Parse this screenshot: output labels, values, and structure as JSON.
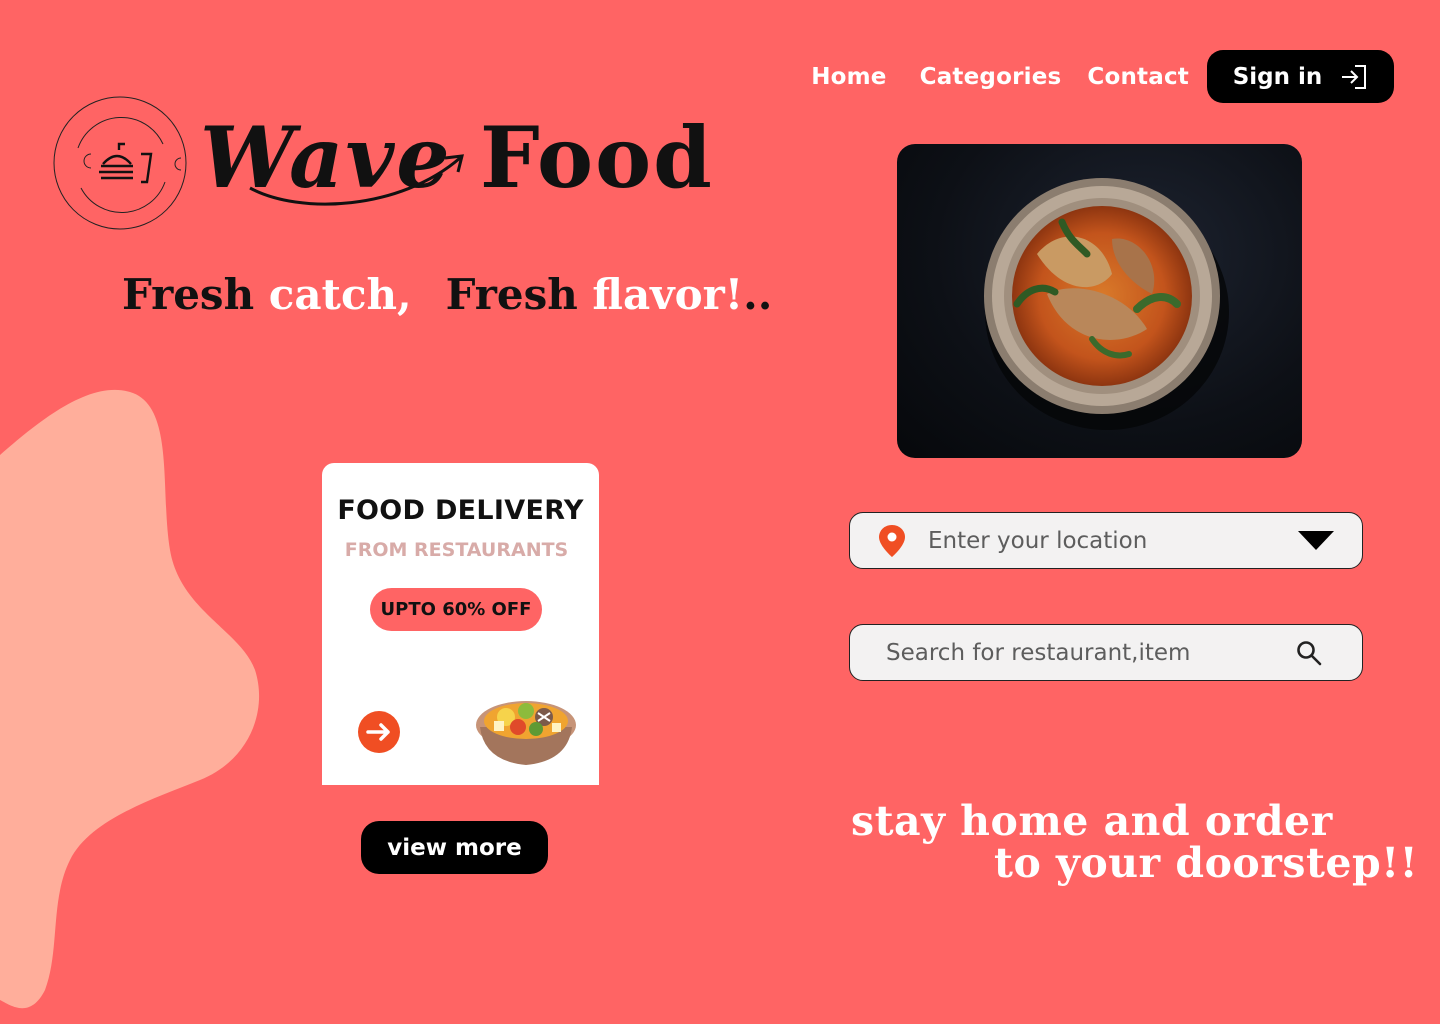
{
  "brand": {
    "name_part1": "Wave",
    "name_part2": "Food"
  },
  "nav": {
    "items": [
      "Home",
      "Categories",
      "Contact"
    ],
    "signin_label": "Sign in"
  },
  "tagline": {
    "part1": "Fresh",
    "part2": "catch,",
    "part3": "Fresh",
    "part4": "flavor!",
    "part5": ".."
  },
  "location": {
    "placeholder": "Enter your location",
    "value": ""
  },
  "search": {
    "placeholder": "Search for restaurant,item",
    "value": ""
  },
  "promo_card": {
    "title": "FOOD DELIVERY",
    "subtitle": "FROM RESTAURANTS",
    "badge": "UPTO 60% OFF"
  },
  "view_more_label": "view more",
  "slogan": {
    "line1": "stay home and order",
    "line2": "to your doorstep!!"
  },
  "colors": {
    "background": "#FF6464",
    "blob": "#FFAE9B",
    "accent_orange": "#F04E23",
    "subtitle_pink": "#D8ABA8",
    "dark": "#000000"
  }
}
